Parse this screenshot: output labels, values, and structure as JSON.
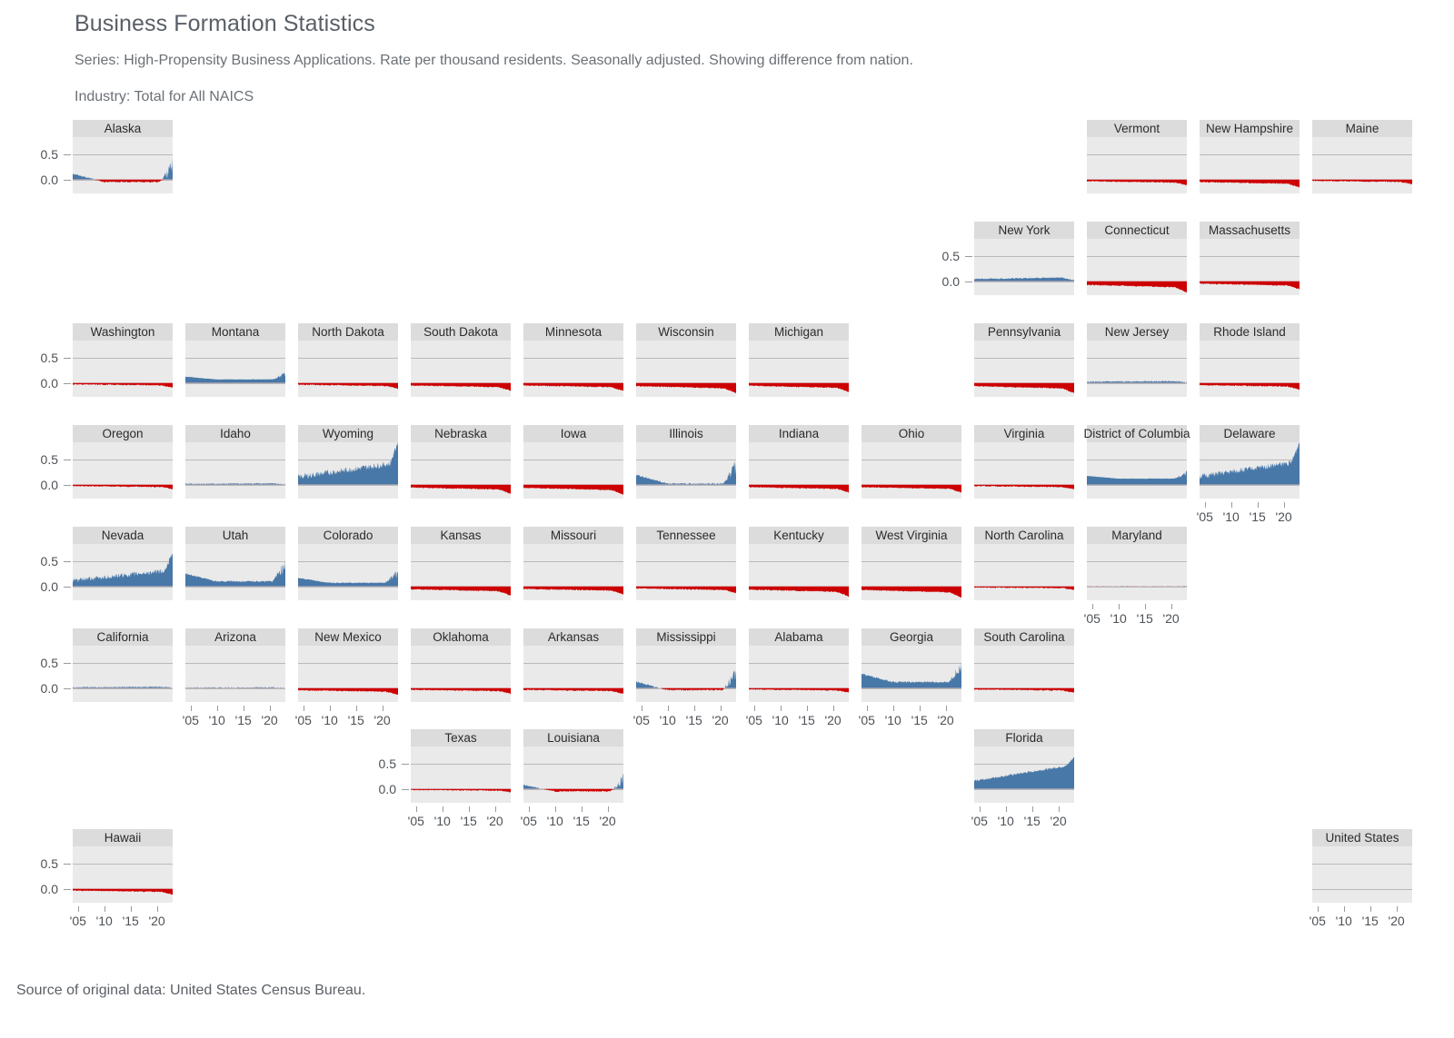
{
  "header": {
    "title": "Business Formation Statistics",
    "subtitle": "Series: High-Propensity Business Applications. Rate per thousand residents. Seasonally adjusted. Showing difference from nation.",
    "industry": "Industry: Total for All NAICS"
  },
  "footer": {
    "source": "Source of original data: United States Census Bureau."
  },
  "colors": {
    "positive": "#4878a8",
    "negative": "#cc0000",
    "panel_background": "#eaeaea",
    "strip_background": "#dcdcdc",
    "gridline": "#b9b9b9",
    "page_background": "#ffffff",
    "text": "#4d5156"
  },
  "axes": {
    "y_ticks": [
      "0.5",
      "0.0"
    ],
    "y_values": [
      0.5,
      0.0
    ],
    "y_limits": [
      -0.28,
      0.85
    ],
    "x_ticks": [
      "'05",
      "'10",
      "'15",
      "'20"
    ],
    "x_values": [
      2005,
      2010,
      2015,
      2020
    ],
    "x_limits": [
      2004.0,
      2023.0
    ]
  },
  "chart_data": {
    "type": "area",
    "title": "Business Formation Statistics",
    "subtitle": "Series: High-Propensity Business Applications. Rate per thousand residents. Seasonally adjusted. Showing difference from nation.",
    "xlabel": "",
    "ylabel": "",
    "ylim": [
      -0.28,
      0.85
    ],
    "xlim": [
      2004,
      2023
    ],
    "grid": true,
    "legend": "none",
    "layout": "geographic tile grid of US states, 11 columns x 8 rows",
    "encoding": "filled area from zero; blue above zero, red below zero",
    "panels": [
      {
        "name": "Alaska",
        "row": 0,
        "col": 0,
        "xaxis": false,
        "yaxis": true,
        "mean": -0.05,
        "peak": 0.25,
        "seed": 11
      },
      {
        "name": "Vermont",
        "row": 0,
        "col": 9,
        "xaxis": false,
        "yaxis": false,
        "mean": -0.05,
        "peak": 0.12,
        "seed": 12
      },
      {
        "name": "New Hampshire",
        "row": 0,
        "col": 10,
        "xaxis": false,
        "yaxis": false,
        "mean": -0.07,
        "peak": 0.0,
        "seed": 13
      },
      {
        "name": "Maine",
        "row": 0,
        "col": 11,
        "xaxis": false,
        "yaxis": false,
        "mean": -0.04,
        "peak": 0.0,
        "seed": 14
      },
      {
        "name": "New York",
        "row": 1,
        "col": 8,
        "xaxis": false,
        "yaxis": true,
        "mean": 0.06,
        "peak": 0.12,
        "seed": 21
      },
      {
        "name": "Connecticut",
        "row": 1,
        "col": 9,
        "xaxis": false,
        "yaxis": false,
        "mean": -0.1,
        "peak": 0.0,
        "seed": 22
      },
      {
        "name": "Massachusetts",
        "row": 1,
        "col": 10,
        "xaxis": false,
        "yaxis": false,
        "mean": -0.07,
        "peak": 0.0,
        "seed": 23
      },
      {
        "name": "Washington",
        "row": 2,
        "col": 0,
        "xaxis": false,
        "yaxis": true,
        "mean": -0.04,
        "peak": 0.0,
        "seed": 31
      },
      {
        "name": "Montana",
        "row": 2,
        "col": 1,
        "xaxis": false,
        "yaxis": false,
        "mean": 0.07,
        "peak": 0.17,
        "seed": 32
      },
      {
        "name": "North Dakota",
        "row": 2,
        "col": 2,
        "xaxis": false,
        "yaxis": false,
        "mean": -0.05,
        "peak": 0.08,
        "seed": 33
      },
      {
        "name": "South Dakota",
        "row": 2,
        "col": 3,
        "xaxis": false,
        "yaxis": false,
        "mean": -0.07,
        "peak": 0.0,
        "seed": 34
      },
      {
        "name": "Minnesota",
        "row": 2,
        "col": 4,
        "xaxis": false,
        "yaxis": false,
        "mean": -0.07,
        "peak": 0.05,
        "seed": 35
      },
      {
        "name": "Wisconsin",
        "row": 2,
        "col": 5,
        "xaxis": false,
        "yaxis": false,
        "mean": -0.09,
        "peak": 0.0,
        "seed": 36
      },
      {
        "name": "Michigan",
        "row": 2,
        "col": 6,
        "xaxis": false,
        "yaxis": false,
        "mean": -0.08,
        "peak": 0.0,
        "seed": 37
      },
      {
        "name": "Pennsylvania",
        "row": 2,
        "col": 8,
        "xaxis": false,
        "yaxis": false,
        "mean": -0.09,
        "peak": 0.0,
        "seed": 38
      },
      {
        "name": "New Jersey",
        "row": 2,
        "col": 9,
        "xaxis": false,
        "yaxis": false,
        "mean": 0.03,
        "peak": 0.06,
        "seed": 39
      },
      {
        "name": "Rhode Island",
        "row": 2,
        "col": 10,
        "xaxis": false,
        "yaxis": false,
        "mean": -0.06,
        "peak": 0.0,
        "seed": 40
      },
      {
        "name": "Oregon",
        "row": 3,
        "col": 0,
        "xaxis": false,
        "yaxis": true,
        "mean": -0.04,
        "peak": 0.0,
        "seed": 41
      },
      {
        "name": "Idaho",
        "row": 3,
        "col": 1,
        "xaxis": false,
        "yaxis": false,
        "mean": 0.02,
        "peak": 0.12,
        "seed": 42
      },
      {
        "name": "Wyoming",
        "row": 3,
        "col": 2,
        "xaxis": false,
        "yaxis": false,
        "mean": 0.3,
        "peak": 0.8,
        "seed": 43
      },
      {
        "name": "Nebraska",
        "row": 3,
        "col": 3,
        "xaxis": false,
        "yaxis": false,
        "mean": -0.08,
        "peak": 0.0,
        "seed": 44
      },
      {
        "name": "Iowa",
        "row": 3,
        "col": 4,
        "xaxis": false,
        "yaxis": false,
        "mean": -0.09,
        "peak": 0.0,
        "seed": 45
      },
      {
        "name": "Illinois",
        "row": 3,
        "col": 5,
        "xaxis": false,
        "yaxis": false,
        "mean": 0.02,
        "peak": 0.34,
        "seed": 46
      },
      {
        "name": "Indiana",
        "row": 3,
        "col": 6,
        "xaxis": false,
        "yaxis": false,
        "mean": -0.07,
        "peak": 0.0,
        "seed": 47
      },
      {
        "name": "Ohio",
        "row": 3,
        "col": 7,
        "xaxis": false,
        "yaxis": false,
        "mean": -0.07,
        "peak": 0.0,
        "seed": 48
      },
      {
        "name": "Virginia",
        "row": 3,
        "col": 8,
        "xaxis": false,
        "yaxis": false,
        "mean": -0.04,
        "peak": 0.02,
        "seed": 49
      },
      {
        "name": "District of Columbia",
        "row": 3,
        "col": 9,
        "xaxis": false,
        "yaxis": false,
        "mean": 0.12,
        "peak": 0.22,
        "seed": 50
      },
      {
        "name": "Delaware",
        "row": 3,
        "col": 10,
        "xaxis": true,
        "yaxis": false,
        "mean": 0.32,
        "peak": 0.78,
        "seed": 51
      },
      {
        "name": "Nevada",
        "row": 4,
        "col": 0,
        "xaxis": false,
        "yaxis": true,
        "mean": 0.22,
        "peak": 0.62,
        "seed": 61
      },
      {
        "name": "Utah",
        "row": 4,
        "col": 1,
        "xaxis": false,
        "yaxis": false,
        "mean": 0.1,
        "peak": 0.38,
        "seed": 62
      },
      {
        "name": "Colorado",
        "row": 4,
        "col": 2,
        "xaxis": false,
        "yaxis": false,
        "mean": 0.07,
        "peak": 0.25,
        "seed": 63
      },
      {
        "name": "Kansas",
        "row": 4,
        "col": 3,
        "xaxis": false,
        "yaxis": false,
        "mean": -0.08,
        "peak": 0.0,
        "seed": 64
      },
      {
        "name": "Missouri",
        "row": 4,
        "col": 4,
        "xaxis": false,
        "yaxis": false,
        "mean": -0.07,
        "peak": 0.0,
        "seed": 65
      },
      {
        "name": "Tennessee",
        "row": 4,
        "col": 5,
        "xaxis": false,
        "yaxis": false,
        "mean": -0.06,
        "peak": 0.0,
        "seed": 66
      },
      {
        "name": "Kentucky",
        "row": 4,
        "col": 6,
        "xaxis": false,
        "yaxis": false,
        "mean": -0.09,
        "peak": 0.0,
        "seed": 67
      },
      {
        "name": "West Virginia",
        "row": 4,
        "col": 7,
        "xaxis": false,
        "yaxis": false,
        "mean": -0.1,
        "peak": 0.0,
        "seed": 68
      },
      {
        "name": "North Carolina",
        "row": 4,
        "col": 8,
        "xaxis": false,
        "yaxis": false,
        "mean": -0.03,
        "peak": 0.02,
        "seed": 69
      },
      {
        "name": "Maryland",
        "row": 4,
        "col": 9,
        "xaxis": true,
        "yaxis": false,
        "mean": 0.0,
        "peak": 0.05,
        "seed": 70
      },
      {
        "name": "California",
        "row": 5,
        "col": 0,
        "xaxis": false,
        "yaxis": true,
        "mean": 0.02,
        "peak": 0.07,
        "seed": 81
      },
      {
        "name": "Arizona",
        "row": 5,
        "col": 1,
        "xaxis": true,
        "yaxis": false,
        "mean": 0.01,
        "peak": 0.1,
        "seed": 82
      },
      {
        "name": "New Mexico",
        "row": 5,
        "col": 2,
        "xaxis": true,
        "yaxis": false,
        "mean": -0.06,
        "peak": 0.02,
        "seed": 83
      },
      {
        "name": "Oklahoma",
        "row": 5,
        "col": 3,
        "xaxis": false,
        "yaxis": false,
        "mean": -0.05,
        "peak": 0.0,
        "seed": 84
      },
      {
        "name": "Arkansas",
        "row": 5,
        "col": 4,
        "xaxis": false,
        "yaxis": false,
        "mean": -0.05,
        "peak": 0.0,
        "seed": 85
      },
      {
        "name": "Mississippi",
        "row": 5,
        "col": 5,
        "xaxis": true,
        "yaxis": false,
        "mean": -0.04,
        "peak": 0.26,
        "seed": 86
      },
      {
        "name": "Alabama",
        "row": 5,
        "col": 6,
        "xaxis": true,
        "yaxis": false,
        "mean": -0.04,
        "peak": 0.04,
        "seed": 87
      },
      {
        "name": "Georgia",
        "row": 5,
        "col": 7,
        "xaxis": true,
        "yaxis": false,
        "mean": 0.12,
        "peak": 0.42,
        "seed": 88
      },
      {
        "name": "South Carolina",
        "row": 5,
        "col": 8,
        "xaxis": false,
        "yaxis": false,
        "mean": -0.04,
        "peak": 0.02,
        "seed": 89
      },
      {
        "name": "Texas",
        "row": 6,
        "col": 3,
        "xaxis": true,
        "yaxis": true,
        "mean": -0.03,
        "peak": 0.02,
        "seed": 91
      },
      {
        "name": "Louisiana",
        "row": 6,
        "col": 4,
        "xaxis": true,
        "yaxis": false,
        "mean": -0.05,
        "peak": 0.18,
        "seed": 92
      },
      {
        "name": "Florida",
        "row": 6,
        "col": 8,
        "xaxis": true,
        "yaxis": false,
        "mean": 0.34,
        "peak": 0.52,
        "seed": 93
      },
      {
        "name": "Hawaii",
        "row": 7,
        "col": 0,
        "xaxis": true,
        "yaxis": true,
        "mean": -0.05,
        "peak": 0.0,
        "seed": 101
      },
      {
        "name": "United States",
        "row": 7,
        "col": 11,
        "xaxis": true,
        "yaxis": false,
        "mean": 0.0,
        "peak": 0.0,
        "seed": 102,
        "empty": true
      }
    ]
  }
}
